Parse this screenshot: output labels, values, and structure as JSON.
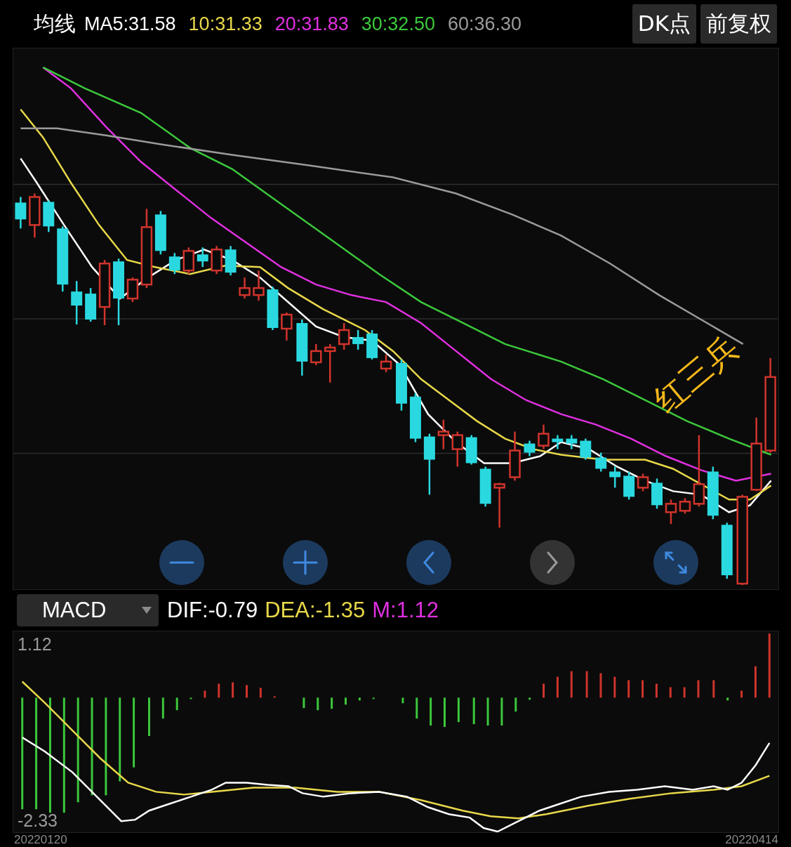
{
  "header": {
    "title": "均线",
    "ma": [
      {
        "label": "MA5:31.58",
        "color": "#ffffff"
      },
      {
        "label": "10:31.33",
        "color": "#e8d84a"
      },
      {
        "label": "20:31.83",
        "color": "#e030e0"
      },
      {
        "label": "30:32.50",
        "color": "#3cc83c"
      },
      {
        "label": "60:36.30",
        "color": "#9a9a9a"
      }
    ],
    "buttons": [
      "DK点",
      "前复权"
    ]
  },
  "main_chart": {
    "annotation": "红三兵",
    "controls": [
      {
        "kind": "zoom_out",
        "disabled": false
      },
      {
        "kind": "zoom_in",
        "disabled": false
      },
      {
        "kind": "prev",
        "disabled": false
      },
      {
        "kind": "next",
        "disabled": true
      },
      {
        "kind": "fullscreen",
        "disabled": false
      }
    ]
  },
  "indicator": {
    "selector": "MACD",
    "readings": [
      {
        "label": "DIF:-0.79",
        "color": "#ffffff"
      },
      {
        "label": "DEA:-1.35",
        "color": "#e8d84a"
      },
      {
        "label": "M:1.12",
        "color": "#e030e0"
      }
    ]
  },
  "macd_chart": {
    "top_label": "1.12",
    "bottom_label": "-2.33"
  },
  "dates": [
    "20220120",
    "20220414"
  ]
}
